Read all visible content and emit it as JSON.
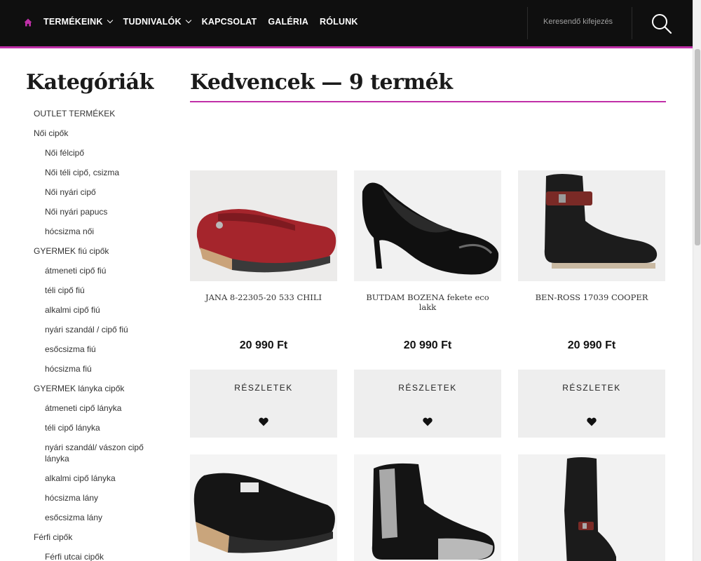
{
  "header": {
    "nav": [
      {
        "label": "TERMÉKEINK",
        "has_dropdown": true
      },
      {
        "label": "TUDNIVALÓK",
        "has_dropdown": true
      },
      {
        "label": "KAPCSOLAT",
        "has_dropdown": false
      },
      {
        "label": "GALÉRIA",
        "has_dropdown": false
      },
      {
        "label": "RÓLUNK",
        "has_dropdown": false
      }
    ],
    "search_placeholder": "Keresendő kifejezés"
  },
  "sidebar": {
    "title": "Kategóriák",
    "items": [
      {
        "label": "OUTLET TERMÉKEK",
        "level": 0
      },
      {
        "label": "Női cipők",
        "level": 0
      },
      {
        "label": "Női félcipő",
        "level": 1
      },
      {
        "label": "Női téli cipő, csizma",
        "level": 1
      },
      {
        "label": "Női nyári cipő",
        "level": 1
      },
      {
        "label": "Női nyári papucs",
        "level": 1
      },
      {
        "label": "hócsizma női",
        "level": 1
      },
      {
        "label": "GYERMEK fiú cipők",
        "level": 0
      },
      {
        "label": "átmeneti cipő fiú",
        "level": 1
      },
      {
        "label": "téli cipő fiú",
        "level": 1
      },
      {
        "label": "alkalmi cipő fiú",
        "level": 1
      },
      {
        "label": "nyári szandál / cipő fiú",
        "level": 1
      },
      {
        "label": "esőcsizma fiú",
        "level": 1
      },
      {
        "label": "hócsizma fiú",
        "level": 1
      },
      {
        "label": "GYERMEK lányka cipők",
        "level": 0
      },
      {
        "label": "átmeneti cipő lányka",
        "level": 1
      },
      {
        "label": "téli cipő lányka",
        "level": 1
      },
      {
        "label": "nyári szandál/ vászon cipő lányka",
        "level": 1
      },
      {
        "label": "alkalmi cipő lányka",
        "level": 1
      },
      {
        "label": "hócsizma lány",
        "level": 1
      },
      {
        "label": "esőcsizma lány",
        "level": 1
      },
      {
        "label": "Férfi cipők",
        "level": 0
      },
      {
        "label": "Férfi utcai cipők",
        "level": 1
      }
    ]
  },
  "main": {
    "title": "Kedvencek — 9 termék",
    "products": [
      {
        "name": "JANA 8-22305-20 533 CHILI",
        "price": "20 990 Ft",
        "details_label": "RÉSZLETEK"
      },
      {
        "name": "BUTDAM BOZENA fekete eco lakk",
        "price": "20 990 Ft",
        "details_label": "RÉSZLETEK"
      },
      {
        "name": "BEN-ROSS 17039 COOPER",
        "price": "20 990 Ft",
        "details_label": "RÉSZLETEK"
      }
    ]
  },
  "colors": {
    "accent": "#c02fa8",
    "header_bg": "#0f0f0f",
    "card_bg": "#eeeeee"
  }
}
